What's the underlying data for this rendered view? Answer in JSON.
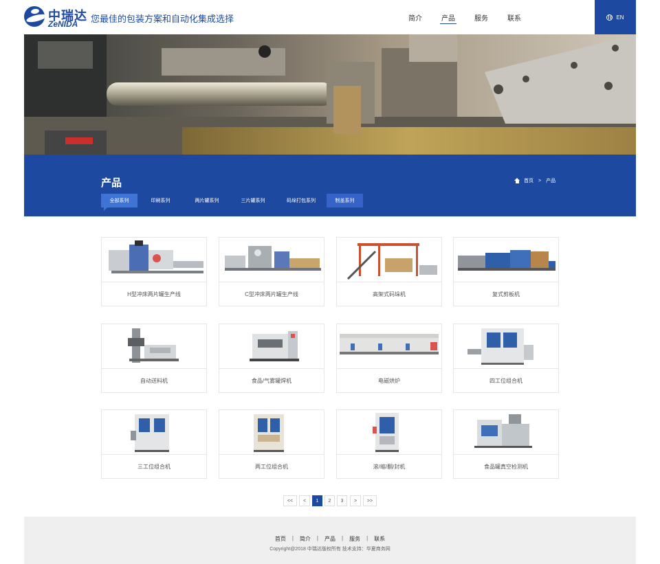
{
  "header": {
    "logo_cn": "中瑞达",
    "logo_en": "ZeNIDA",
    "slogan": "您最佳的包装方案和自动化集成选择",
    "nav": [
      {
        "label": "简介"
      },
      {
        "label": "产品",
        "active": true
      },
      {
        "label": "服务"
      },
      {
        "label": "联系"
      }
    ],
    "lang_label": "EN"
  },
  "band": {
    "title": "产品",
    "breadcrumb": {
      "home": "首页",
      "sep": ">",
      "current": "产品"
    },
    "tabs": [
      {
        "label": "全部系列",
        "active": true
      },
      {
        "label": "印刷系列"
      },
      {
        "label": "两片罐系列"
      },
      {
        "label": "三片罐系列"
      },
      {
        "label": "码垛打包系列"
      },
      {
        "label": "制盖系列",
        "boxed": true
      }
    ]
  },
  "products": [
    {
      "name": "H型冲床两片罐生产线",
      "icon": "line-machine-icon"
    },
    {
      "name": "C型冲床两片罐生产线",
      "icon": "press-line-icon"
    },
    {
      "name": "高架式码垛机",
      "icon": "palletizer-icon"
    },
    {
      "name": "复式剪板机",
      "icon": "shear-machine-icon"
    },
    {
      "name": "自动送料机",
      "icon": "feeder-icon"
    },
    {
      "name": "食品/气雾罐焊机",
      "icon": "welder-icon"
    },
    {
      "name": "电磁烘炉",
      "icon": "oven-icon"
    },
    {
      "name": "四工位组合机",
      "icon": "combination-machine-icon"
    },
    {
      "name": "三工位组合机",
      "icon": "combination-machine-icon"
    },
    {
      "name": "两工位组合机",
      "icon": "combination-machine-icon"
    },
    {
      "name": "滚/缩/翻/封机",
      "icon": "seamer-icon"
    },
    {
      "name": "食品罐真空检测机",
      "icon": "vacuum-tester-icon"
    }
  ],
  "pagination": {
    "first": "<<",
    "prev": "<",
    "pages": [
      "1",
      "2",
      "3"
    ],
    "current": "1",
    "next": ">",
    "last": ">>"
  },
  "footer": {
    "links": [
      "首页",
      "简介",
      "产品",
      "服务",
      "联系"
    ],
    "separator": "|",
    "copyright": "Copyright@2018 中瑞达版权所有     技术支持：华夏商务网"
  },
  "colors": {
    "brand_blue": "#1d4aa0",
    "tab_active": "#3d74d6",
    "footer_bg": "#efefef"
  }
}
